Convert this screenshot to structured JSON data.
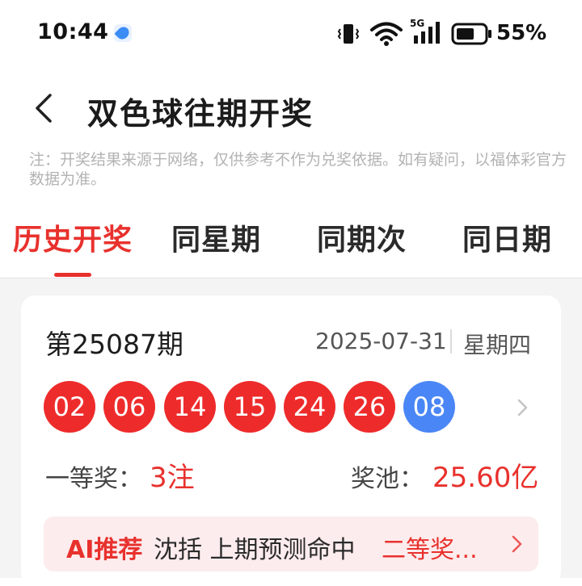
{
  "status_bar": {
    "time": "10:44",
    "network": "5G",
    "battery": "55%",
    "icons": [
      "app-notification-icon",
      "vibrate-icon",
      "wifi-icon",
      "cellular-signal-icon",
      "battery-icon"
    ]
  },
  "header": {
    "title": "双色球往期开奖",
    "back_icon": "back-arrow-icon"
  },
  "disclaimer": "注：开奖结果来源于网络，仅供参考不作为兑奖依据。如有疑问，以福体彩官方数据为准。",
  "tabs": [
    {
      "label": "历史开奖",
      "active": true
    },
    {
      "label": "同星期",
      "active": false
    },
    {
      "label": "同期次",
      "active": false
    },
    {
      "label": "同日期",
      "active": false
    }
  ],
  "draw": {
    "issue": "第25087期",
    "date": "2025-07-31",
    "weekday": "星期四",
    "red_balls": [
      "02",
      "06",
      "14",
      "15",
      "24",
      "26"
    ],
    "blue_ball": "08",
    "first_prize_label": "一等奖：",
    "first_prize_value": "3注",
    "pool_label": "奖池：",
    "pool_value": "25.60亿"
  },
  "ai_banner": {
    "tag": "AI推荐",
    "text": "沈括 上期预测命中",
    "highlight": "二等奖..."
  },
  "colors": {
    "accent_red": "#e8312d",
    "red_ball": "#ee2b2b",
    "blue_ball": "#4a86f5",
    "banner_bg": "#fdeced"
  }
}
